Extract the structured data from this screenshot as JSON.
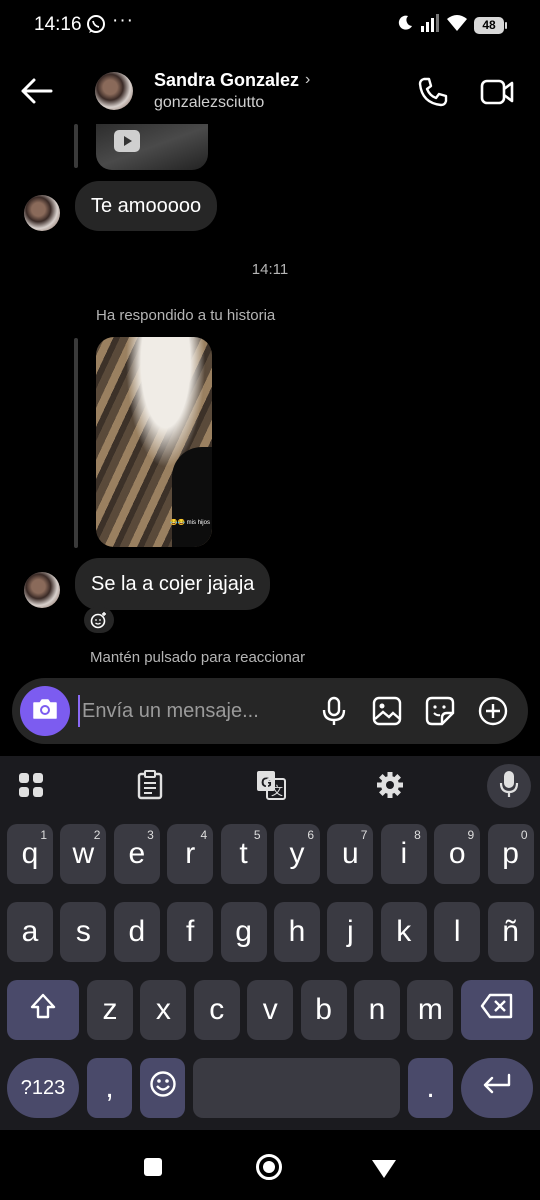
{
  "status_bar": {
    "time": "14:16",
    "more": "···",
    "battery": "48"
  },
  "header": {
    "name": "Sandra Gonzalez",
    "chevron": "›",
    "username": "gonzalezsciutto"
  },
  "chat": {
    "message_1": "Te amooooo",
    "timestamp": "14:11",
    "reply_note": "Ha respondido a tu historia",
    "story_caption": "😂😂 mis hijos",
    "message_2": "Se la a cojer jajaja",
    "reaction_hint": "Mantén pulsado para reaccionar"
  },
  "composer": {
    "placeholder": "Envía un mensaje..."
  },
  "keyboard": {
    "row1": [
      {
        "k": "q",
        "s": "1"
      },
      {
        "k": "w",
        "s": "2"
      },
      {
        "k": "e",
        "s": "3"
      },
      {
        "k": "r",
        "s": "4"
      },
      {
        "k": "t",
        "s": "5"
      },
      {
        "k": "y",
        "s": "6"
      },
      {
        "k": "u",
        "s": "7"
      },
      {
        "k": "i",
        "s": "8"
      },
      {
        "k": "o",
        "s": "9"
      },
      {
        "k": "p",
        "s": "0"
      }
    ],
    "row2": [
      "a",
      "s",
      "d",
      "f",
      "g",
      "h",
      "j",
      "k",
      "l",
      "ñ"
    ],
    "row3": [
      "z",
      "x",
      "c",
      "v",
      "b",
      "n",
      "m"
    ],
    "symbols": "?123",
    "comma": ",",
    "period": "."
  },
  "colors": {
    "accent": "#7c5cf0",
    "bubble": "#262626",
    "key": "#3a3a42",
    "mod_key": "#4a4a6a"
  },
  "icons": [
    "whatsapp-icon",
    "moon-icon",
    "signal-icon",
    "wifi-icon",
    "back-arrow-icon",
    "phone-icon",
    "video-icon",
    "play-icon",
    "emoji-add-icon",
    "camera-icon",
    "mic-icon",
    "image-icon",
    "sticker-icon",
    "plus-circle-icon",
    "apps-grid-icon",
    "clipboard-icon",
    "translate-icon",
    "gear-icon",
    "shift-icon",
    "backspace-icon",
    "emoji-icon",
    "enter-icon"
  ]
}
